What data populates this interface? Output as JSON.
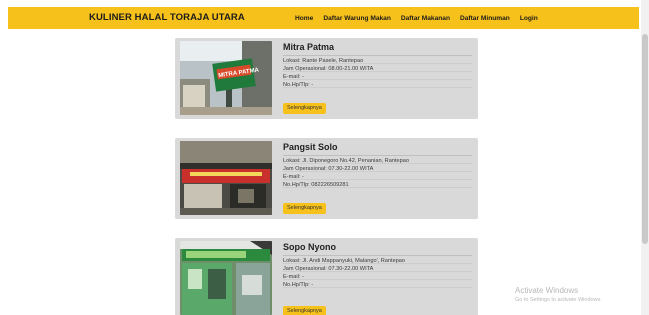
{
  "navbar": {
    "brand": "KULINER HALAL TORAJA UTARA",
    "links": [
      "Home",
      "Daftar Warung Makan",
      "Daftar Makanan",
      "Daftar Minuman",
      "Login"
    ]
  },
  "cards": [
    {
      "name": "Mitra Patma",
      "lokasi": "Lokasi: Rante Pasele, Rantepao",
      "jam": "Jam Operasional: 08.00-21.00 WITA",
      "email": "E-mail: -",
      "hp": "No.Hp/Tlp: -",
      "button": "Selengkapnya",
      "sign_text": "MITRA PATMA",
      "image": "photo-of-warung-mitra-patma"
    },
    {
      "name": "Pangsit Solo",
      "lokasi": "Lokasi: Jl. Diponegoro No.42, Penanian, Rantepao",
      "jam": "Jam Operasional: 07.30-22.00 WITA",
      "email": "E-mail: -",
      "hp": "No.Hp/Tlp: 082226509281",
      "button": "Selengkapnya",
      "image": "photo-of-warung-pangsit-solo"
    },
    {
      "name": "Sopo Nyono",
      "lokasi": "Lokasi: Jl. Andi Mappanyuki, Malango', Rantepao",
      "jam": "Jam Operasional: 07.30-22.00 WITA",
      "email": "E-mail: -",
      "hp": "No.Hp/Tlp: -",
      "button": "Selengkapnya",
      "image": "photo-of-warung-sopo-nyono"
    }
  ],
  "watermark": {
    "title": "Activate Windows",
    "subtitle": "Go to Settings to activate Windows."
  },
  "colors": {
    "accent": "#f7c11b",
    "card_bg": "#d9d9d9",
    "page_bg": "#ffffff"
  }
}
